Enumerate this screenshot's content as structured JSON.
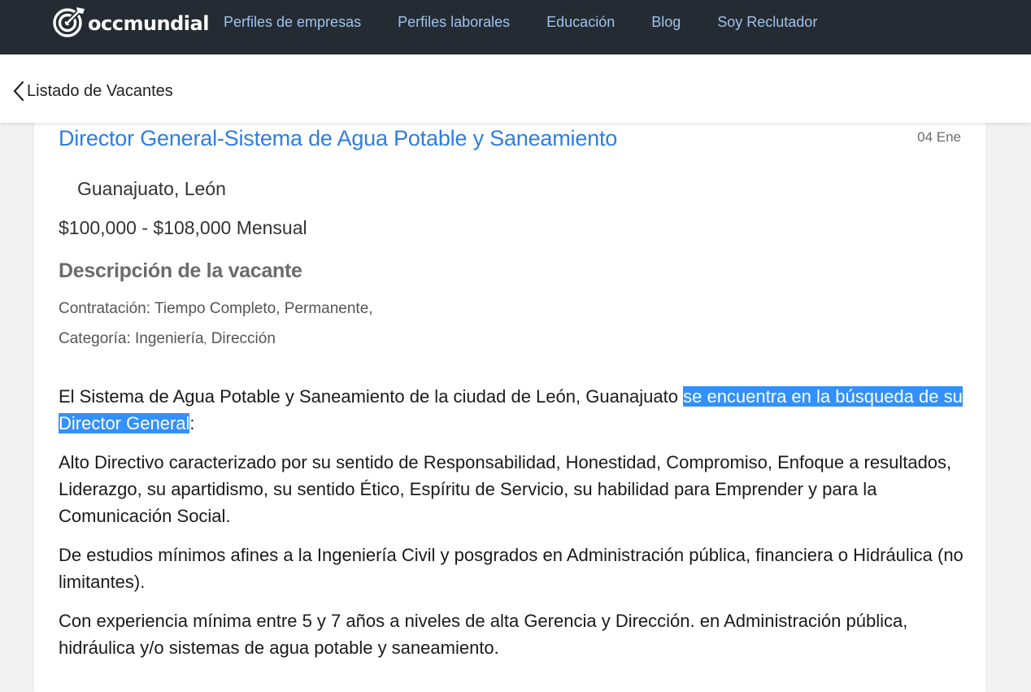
{
  "nav": {
    "logo_text": "occmundial",
    "links": [
      "Perfiles de empresas",
      "Perfiles laborales",
      "Educación",
      "Blog",
      "Soy Reclutador"
    ]
  },
  "subheader": {
    "back_label": "Listado de Vacantes"
  },
  "job": {
    "title": "Director General-Sistema de Agua Potable y Saneamiento",
    "date": "04 Ene",
    "location": "Guanajuato, León",
    "salary": "$100,000 - $108,000 Mensual",
    "section_title": "Descripción de la vacante",
    "contract_label": "Contratación:",
    "contract_value": "Tiempo Completo, Permanente,",
    "category_label": "Categoría:",
    "categories": [
      "Ingeniería",
      "Dirección"
    ],
    "category_separator": ",",
    "description": {
      "p1_before": "El Sistema de Agua Potable y Saneamiento de la ciudad de León, Guanajuato ",
      "p1_highlight": "se encuentra en la búsqueda de su Director General",
      "p1_after": ":",
      "p2": "Alto Directivo caracterizado por su sentido de Responsabilidad, Honestidad, Compromiso, Enfoque a resultados, Liderazgo, su apartidismo, su sentido Ético, Espíritu de Servicio, su habilidad para Emprender y para la Comunicación Social.",
      "p3": "De estudios mínimos afines a la Ingeniería Civil y posgrados en Administración pública, financiera o Hidráulica (no limitantes).",
      "p4": "Con experiencia mínima entre 5 y 7 años a niveles de alta Gerencia y Dirección. en Administración pública, hidráulica y/o sistemas de agua potable y saneamiento."
    }
  },
  "colors": {
    "nav_bg": "#242b33",
    "nav_link": "#9fc2ea",
    "title_link": "#2f7de1",
    "highlight_bg": "#3390ff"
  },
  "icons": {
    "logo": "occ-target-logo-icon",
    "back": "chevron-left-icon"
  }
}
